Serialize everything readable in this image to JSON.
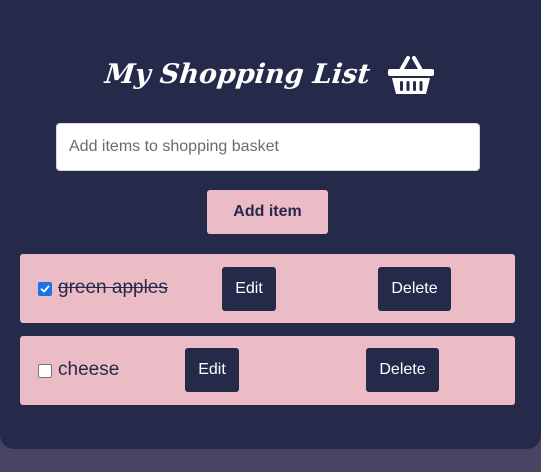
{
  "header": {
    "title": "My Shopping List",
    "icon": "basket-icon"
  },
  "add_form": {
    "placeholder": "Add items to shopping basket",
    "value": "",
    "button_label": "Add item"
  },
  "items": [
    {
      "label": "green apples",
      "checked": true,
      "edit_label": "Edit",
      "delete_label": "Delete"
    },
    {
      "label": "cheese",
      "checked": false,
      "edit_label": "Edit",
      "delete_label": "Delete"
    }
  ],
  "colors": {
    "card_background": "#252a4b",
    "page_background": "#4a4363",
    "accent_pink": "#ebbcc5",
    "checkbox_blue": "#1a73e8"
  }
}
